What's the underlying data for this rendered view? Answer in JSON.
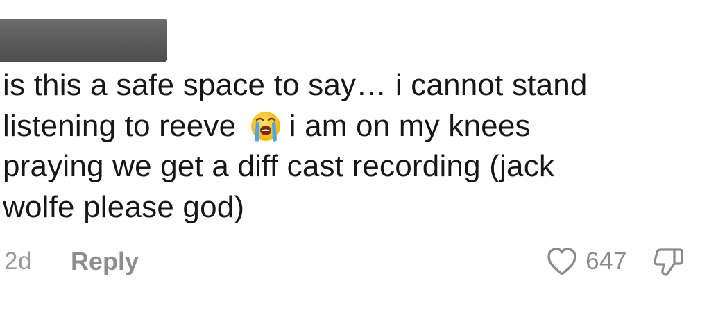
{
  "comment": {
    "text_line_1": "is this a safe space to say… i cannot stand",
    "text_line_2_before_emoji": "listening to reeve",
    "emoji": "loudly-crying-face",
    "text_line_2_after_emoji": "i am on my knees",
    "text_line_3": "praying we get a diff cast recording (jack",
    "text_line_4": "wolfe please god)",
    "timestamp": "2d",
    "reply_label": "Reply",
    "like_count": "647"
  },
  "icons": {
    "like": "heart-outline-icon",
    "dislike": "thumbs-down-icon"
  },
  "colors": {
    "text": "#161616",
    "meta": "#9a9a9a",
    "redaction": "#5f5f5f"
  }
}
